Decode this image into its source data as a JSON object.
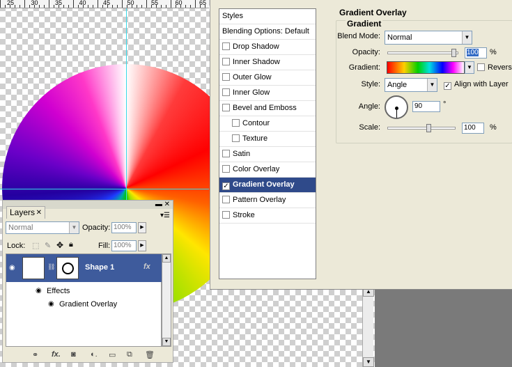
{
  "ruler": {
    "ticks": [
      "25",
      "30",
      "35",
      "40",
      "45",
      "50",
      "55",
      "60",
      "65"
    ]
  },
  "dialog": {
    "styles_list": {
      "header": "Styles",
      "blending": "Blending Options: Default",
      "items": [
        {
          "label": "Drop Shadow",
          "checked": false,
          "indent": false
        },
        {
          "label": "Inner Shadow",
          "checked": false,
          "indent": false
        },
        {
          "label": "Outer Glow",
          "checked": false,
          "indent": false
        },
        {
          "label": "Inner Glow",
          "checked": false,
          "indent": false
        },
        {
          "label": "Bevel and Emboss",
          "checked": false,
          "indent": false
        },
        {
          "label": "Contour",
          "checked": false,
          "indent": true
        },
        {
          "label": "Texture",
          "checked": false,
          "indent": true
        },
        {
          "label": "Satin",
          "checked": false,
          "indent": false
        },
        {
          "label": "Color Overlay",
          "checked": false,
          "indent": false
        },
        {
          "label": "Gradient Overlay",
          "checked": true,
          "indent": false,
          "selected": true
        },
        {
          "label": "Pattern Overlay",
          "checked": false,
          "indent": false
        },
        {
          "label": "Stroke",
          "checked": false,
          "indent": false
        }
      ]
    },
    "panel": {
      "title": "Gradient Overlay",
      "group_title": "Gradient",
      "blend_mode_label": "Blend Mode:",
      "blend_mode_value": "Normal",
      "opacity_label": "Opacity:",
      "opacity_value": "100",
      "opacity_unit": "%",
      "opacity_level": 1.0,
      "gradient_label": "Gradient:",
      "reverse_label": "Reverse",
      "reverse_checked": false,
      "style_label": "Style:",
      "style_value": "Angle",
      "align_label": "Align with Layer",
      "align_checked": true,
      "angle_label": "Angle:",
      "angle_value": "90",
      "angle_unit": "°",
      "scale_label": "Scale:",
      "scale_value": "100",
      "scale_unit": "%"
    }
  },
  "layers_panel": {
    "tab_label": "Layers",
    "blend_value": "Normal",
    "opacity_label": "Opacity:",
    "opacity_value": "100%",
    "lock_label": "Lock:",
    "fill_label": "Fill:",
    "fill_value": "100%",
    "layer_name": "Shape 1",
    "effects_label": "Effects",
    "effect_item": "Gradient Overlay"
  },
  "icons": [
    "eye-icon",
    "chain-link-icon",
    "fx-icon",
    "mask-icon",
    "adjustment-icon",
    "folder-icon",
    "new-layer-icon",
    "trash-icon",
    "lock-transparent-icon",
    "lock-brush-icon",
    "lock-move-icon",
    "lock-all-icon"
  ]
}
